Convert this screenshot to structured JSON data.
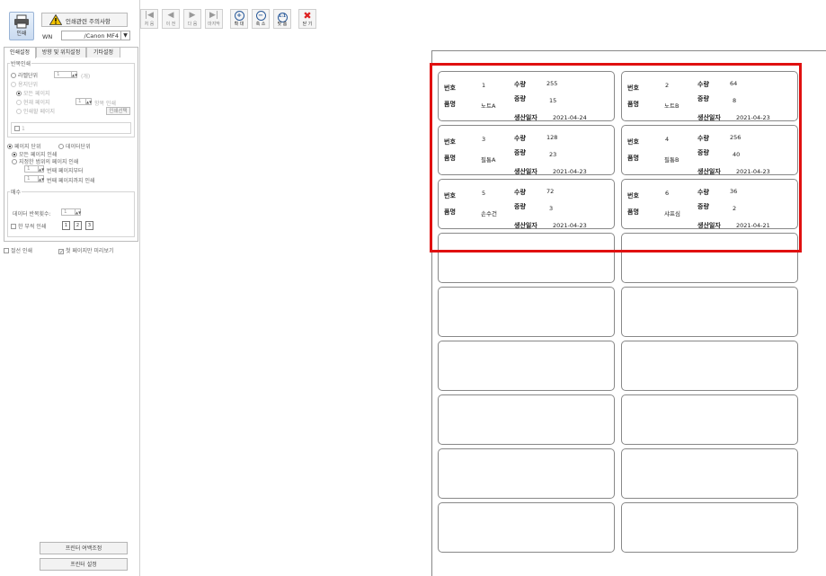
{
  "toolbar": {
    "print_label": "인쇄",
    "warning_label": "인쇄관련 주의사항",
    "printer_label": "WN",
    "printer_value": "/Canon MF4",
    "buttons": [
      {
        "name": "first",
        "icon": "|◀",
        "label": "처 음",
        "enabled": false
      },
      {
        "name": "prev",
        "icon": "◀",
        "label": "이 전",
        "enabled": false
      },
      {
        "name": "next",
        "icon": "▶",
        "label": "다 음",
        "enabled": false
      },
      {
        "name": "last",
        "icon": "▶|",
        "label": "마지막",
        "enabled": false
      },
      {
        "name": "zoom-in",
        "icon": "+",
        "label": "확 대",
        "enabled": true
      },
      {
        "name": "zoom-out",
        "icon": "−",
        "label": "축 소",
        "enabled": true
      },
      {
        "name": "fit",
        "icon": "1:1",
        "label": "맞 춤",
        "enabled": true
      },
      {
        "name": "close",
        "icon": "✖",
        "label": "닫 기",
        "enabled": true
      }
    ]
  },
  "settings": {
    "tabs": [
      "인쇄설정",
      "방향 및 위치설정",
      "기타설정"
    ],
    "repeat_group": "반복인쇄",
    "repeat_unit": "라벨단위",
    "repeat_count": "1",
    "repeat_suffix": "(개)",
    "page_unit": "용지단위",
    "all_pages": "모든 페이지",
    "current_page": "현재 페이지",
    "current_page_num": "1",
    "item_print": "항목 인쇄",
    "print_page": "인쇄할 페이지",
    "range_select": "인쇄선택",
    "num_input": "1",
    "mode_page": "페이지 단위",
    "mode_data": "데이터단위",
    "all_page_print": "모든 페이지 인쇄",
    "range_print": "지정한 범위의 페이지 인쇄",
    "from_num": "1",
    "from_label": "번째 페이지부터",
    "to_num": "1",
    "to_label": "번째 페이지까지 인쇄",
    "copies_group": "매수",
    "data_repeat": "데이터 반복횟수:",
    "data_repeat_val": "1",
    "collate": "한 부씩 인쇄",
    "line_print": "절선 인쇄",
    "first_preview": "첫 페이지만 미리보기",
    "margin_btn": "프린터 여백조정",
    "printer_btn": "프린터 설정"
  },
  "labels_text": {
    "num": "번호",
    "qty": "수량",
    "name": "품명",
    "weight": "중량",
    "date": "생산일자"
  },
  "labels": [
    {
      "num": "1",
      "qty": "255",
      "name": "노트A",
      "weight": "15",
      "date": "2021-04-24"
    },
    {
      "num": "2",
      "qty": "64",
      "name": "노트B",
      "weight": "8",
      "date": "2021-04-23"
    },
    {
      "num": "3",
      "qty": "128",
      "name": "필통A",
      "weight": "23",
      "date": "2021-04-23"
    },
    {
      "num": "4",
      "qty": "256",
      "name": "필통B",
      "weight": "40",
      "date": "2021-04-23"
    },
    {
      "num": "5",
      "qty": "72",
      "name": "손수건",
      "weight": "3",
      "date": "2021-04-23"
    },
    {
      "num": "6",
      "qty": "36",
      "name": "샤프심",
      "weight": "2",
      "date": "2021-04-21"
    }
  ],
  "empty_labels": 12,
  "colors": {
    "highlight": "#e01010",
    "accent": "#1f4f8f"
  }
}
